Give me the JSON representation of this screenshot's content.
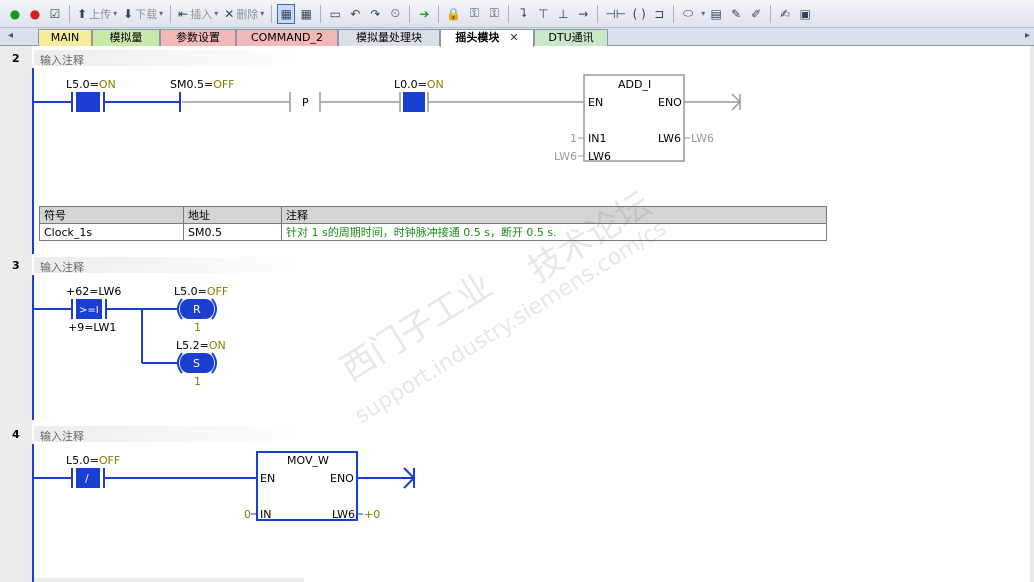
{
  "toolbar": {
    "upload_label": "上传",
    "download_label": "下载",
    "insert_label": "插入",
    "delete_label": "删除"
  },
  "tabs": [
    {
      "label": "MAIN"
    },
    {
      "label": "模拟量"
    },
    {
      "label": "参数设置"
    },
    {
      "label": "COMMAND_2"
    },
    {
      "label": "模拟量处理块"
    },
    {
      "label": "摇头模块"
    },
    {
      "label": "DTU通讯"
    }
  ],
  "tab_colors": [
    "#f5ec9c",
    "#c8e8a8",
    "#f3b8b8",
    "#f3b8b8",
    "#d9e0ea",
    "#ffffff",
    "#c8e8c8"
  ],
  "networks": [
    {
      "number": "2",
      "comment": "输入注释"
    },
    {
      "number": "3",
      "comment": "输入注释"
    },
    {
      "number": "4",
      "comment": "输入注释"
    }
  ],
  "net2": {
    "contact1_addr": "L5.0=",
    "contact1_state": "ON",
    "contact2_addr": "SM0.5=",
    "contact2_state": "OFF",
    "pos_edge": "P",
    "contact3_addr": "L0.0=",
    "contact3_state": "ON",
    "box_title": "ADD_I",
    "pin_en": "EN",
    "pin_eno": "ENO",
    "pin_in1": "IN1",
    "pin_in2": "LW6",
    "pin_out": "LW6",
    "in1_value": "1",
    "in2_value": "LW6",
    "out_value": "LW6"
  },
  "symbol_table": {
    "headers": [
      "符号",
      "地址",
      "注释"
    ],
    "rows": [
      {
        "symbol": "Clock_1s",
        "address": "SM0.5",
        "comment": "针对 1 s的周期时间，时钟脉冲接通 0.5 s，断开 0.5 s."
      }
    ]
  },
  "net3": {
    "compare_top": "+62=LW6",
    "compare_op": ">=I",
    "compare_bottom": "+9=LW1",
    "coil1_addr": "L5.0=",
    "coil1_state": "OFF",
    "coil1_type": "R",
    "coil1_count": "1",
    "coil2_addr": "L5.2=",
    "coil2_state": "ON",
    "coil2_type": "S",
    "coil2_count": "1"
  },
  "net4": {
    "contact_addr": "L5.0=",
    "contact_state": "OFF",
    "contact_type": "/",
    "box_title": "MOV_W",
    "pin_en": "EN",
    "pin_eno": "ENO",
    "pin_in": "IN",
    "pin_out": "LW6",
    "in_value": "0",
    "out_value": "+0"
  },
  "watermark": {
    "line1": "西门子工业",
    "line2": "support.industry.siemens.com/cs",
    "line3": "技术论坛"
  },
  "colors": {
    "rail": "#1a3fd0",
    "active_element": "#1a3fd0",
    "inactive_wire": "#999999",
    "state_text": "#8a7a00",
    "comment_green": "#1b8a1b"
  }
}
